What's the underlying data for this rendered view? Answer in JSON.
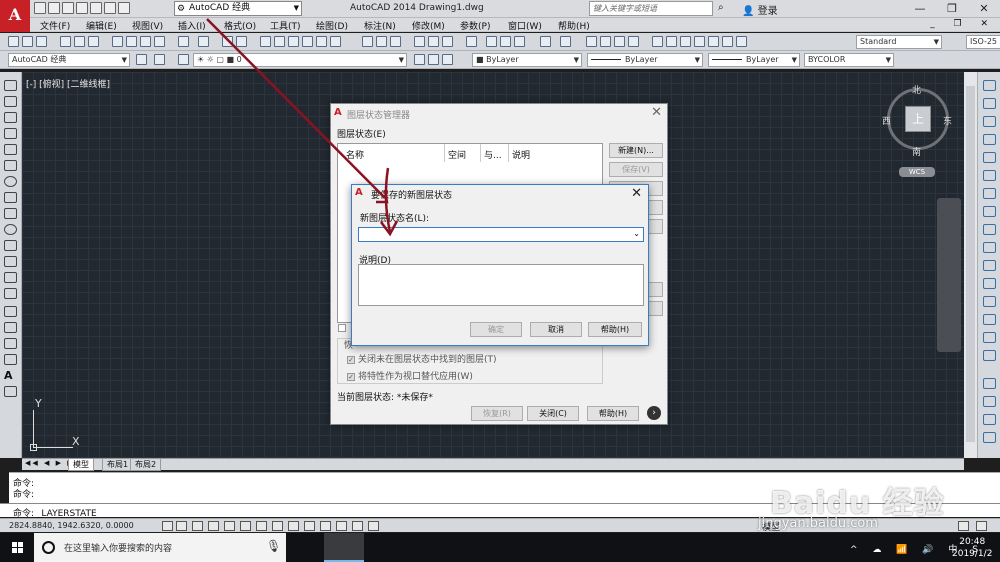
{
  "titlebar": {
    "logo_text": "A",
    "workspace": "AutoCAD 经典",
    "title": "AutoCAD 2014    Drawing1.dwg",
    "search_placeholder": "键入关键字或短语",
    "login": "登录"
  },
  "menu": [
    "文件(F)",
    "编辑(E)",
    "视图(V)",
    "插入(I)",
    "格式(O)",
    "工具(T)",
    "绘图(D)",
    "标注(N)",
    "修改(M)",
    "参数(P)",
    "窗口(W)",
    "帮助(H)"
  ],
  "toolbar": {
    "text_style": "Standard",
    "dim_style": "ISO-25",
    "workspace_combo": "AutoCAD 经典",
    "layer": "0",
    "color": "ByLayer",
    "linetype": "ByLayer",
    "lineweight": "ByLayer",
    "plotstyle": "BYCOLOR"
  },
  "viewport": {
    "label": "[-] [俯视] [二维线框]",
    "cube_top": "上",
    "north": "北",
    "south": "南",
    "west": "西",
    "east": "东",
    "wcs": "WCS",
    "ucs_x": "X",
    "ucs_y": "Y"
  },
  "layout_tabs": [
    "模型",
    "布局1",
    "布局2"
  ],
  "command": {
    "lines": [
      "命令:",
      "命令:"
    ],
    "current": "命令: _LAYERSTATE"
  },
  "status": {
    "coords": "2824.8840,  1942.6320,  0.0000",
    "model": "模型"
  },
  "taskbar": {
    "search_text": "在这里输入你要搜索的内容",
    "time": "20:48",
    "date": "2019/1/2"
  },
  "layer_state_manager": {
    "title": "图层状态管理器",
    "list_label": "图层状态(E)",
    "columns": [
      "名称",
      "空间",
      "与...",
      "说明"
    ],
    "side_buttons": [
      "新建(N)...",
      "保存(V)"
    ],
    "checkbox_restore_off": "关闭未在图层状态中找到的图层(T)",
    "checkbox_viewport": "将特性作为视口替代应用(W)",
    "restore_group_label": "恢",
    "current_state_label": "当前图层状态:",
    "current_state_value": "*未保存*",
    "restore_btn": "恢复(R)",
    "close_btn": "关闭(C)",
    "help_btn": "帮助(H)"
  },
  "new_state_dialog": {
    "title": "要保存的新图层状态",
    "name_label": "新图层状态名(L):",
    "name_value": "",
    "desc_label": "说明(D)",
    "desc_value": "",
    "ok_btn": "确定",
    "cancel_btn": "取消",
    "help_btn": "帮助(H)"
  },
  "watermark": {
    "brand": "Baidu 经验",
    "url": "jingyan.baidu.com"
  },
  "colors": {
    "accent_red": "#c82027",
    "arrow": "#8b1220",
    "canvas_bg": "#212830"
  }
}
